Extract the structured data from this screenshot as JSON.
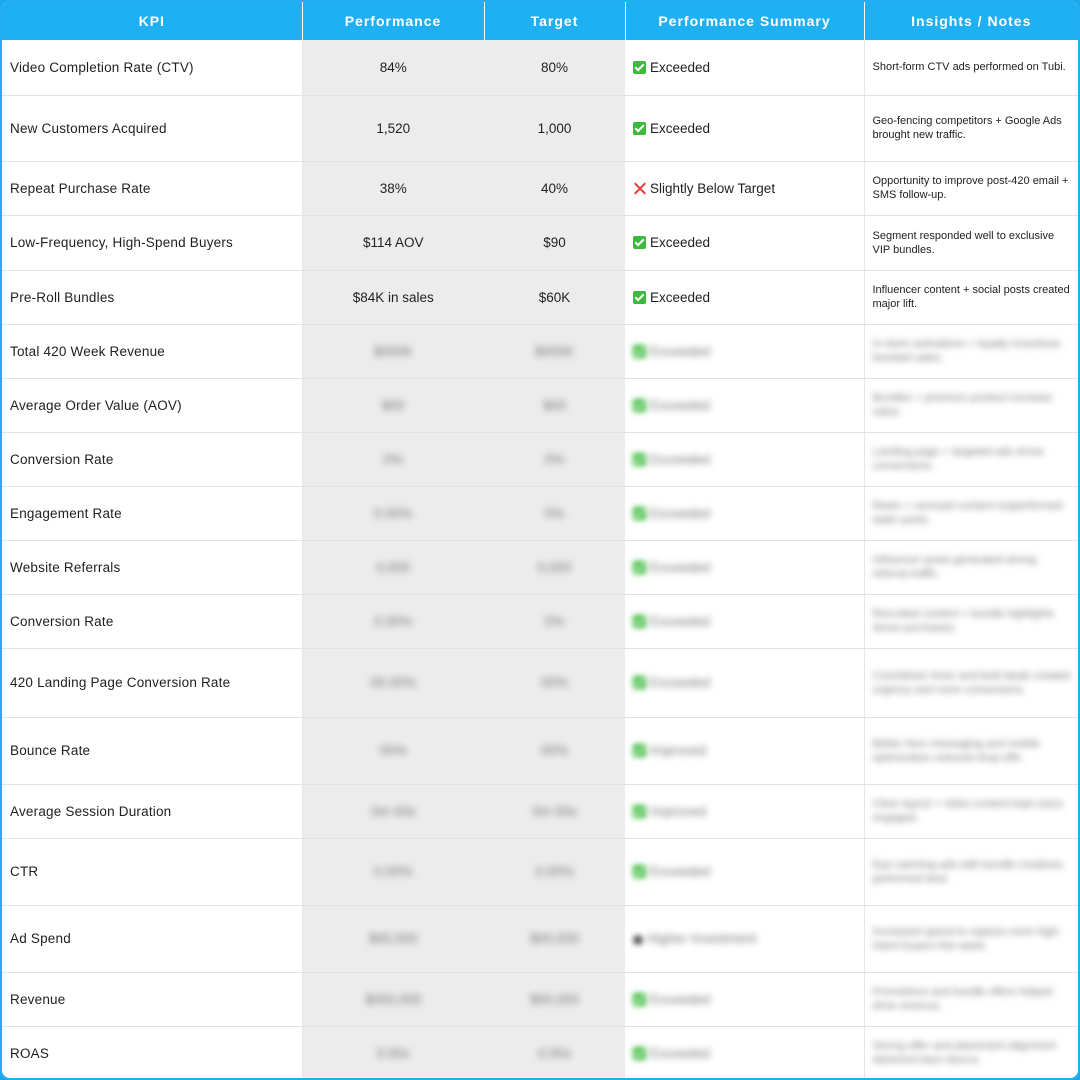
{
  "headers": {
    "kpi": "KPI",
    "performance": "Performance",
    "target": "Target",
    "summary": "Performance Summary",
    "notes": "Insights / Notes"
  },
  "rows": [
    {
      "kpi": "Video Completion Rate (CTV)",
      "performance": "84%",
      "target": "80%",
      "status_icon": "check-icon",
      "summary": "Exceeded",
      "notes": "Short-form CTV ads performed on Tubi."
    },
    {
      "kpi": "New Customers Acquired",
      "performance": "1,520",
      "target": "1,000",
      "status_icon": "check-icon",
      "summary": "Exceeded",
      "notes": "Geo-fencing competitors + Google Ads brought new traffic."
    },
    {
      "kpi": "Repeat Purchase Rate",
      "performance": "38%",
      "target": "40%",
      "status_icon": "cross-icon",
      "summary": "Slightly Below Target",
      "notes": "Opportunity to improve post-420 email + SMS follow-up."
    },
    {
      "kpi": "Low-Frequency, High-Spend Buyers",
      "performance": "$114 AOV",
      "target": "$90",
      "status_icon": "check-icon",
      "summary": "Exceeded",
      "notes": "Segment responded well to exclusive VIP bundles."
    },
    {
      "kpi": "Pre-Roll Bundles",
      "performance": "$84K in sales",
      "target": "$60K",
      "status_icon": "check-icon",
      "summary": "Exceeded",
      "notes": "Influencer content + social posts created major lift."
    },
    {
      "kpi": "Total 420 Week Revenue",
      "performance": "$000K",
      "target": "$000K",
      "status_icon": "check-icon",
      "summary": "Exceeded",
      "notes": "In-store activations + loyalty incentives boosted sales."
    },
    {
      "kpi": "Average Order Value (AOV)",
      "performance": "$00",
      "target": "$00",
      "status_icon": "check-icon",
      "summary": "Exceeded",
      "notes": "Bundles + premium product increase value."
    },
    {
      "kpi": "Conversion Rate",
      "performance": "0%",
      "target": "0%",
      "status_icon": "check-icon",
      "summary": "Exceeded",
      "notes": "Landing page + targeted ads drove conversions."
    },
    {
      "kpi": "Engagement Rate",
      "performance": "0.00%",
      "target": "0%",
      "status_icon": "check-icon",
      "summary": "Exceeded",
      "notes": "Reels + carousel content outperformed static posts."
    },
    {
      "kpi": "Website Referrals",
      "performance": "0,000",
      "target": "0,000",
      "status_icon": "check-icon",
      "summary": "Exceeded",
      "notes": "Influencer posts generated strong referral traffic."
    },
    {
      "kpi": "Conversion Rate",
      "performance": "0.00%",
      "target": "0%",
      "status_icon": "check-icon",
      "summary": "Exceeded",
      "notes": "Recruited content + bundle highlights drove purchases."
    },
    {
      "kpi": "420 Landing Page Conversion Rate",
      "performance": "00.00%",
      "target": "00%",
      "status_icon": "check-icon",
      "summary": "Exceeded",
      "notes": "Countdown timer and bold deals created urgency and more conversions."
    },
    {
      "kpi": "Bounce Rate",
      "performance": "00%",
      "target": "00%",
      "status_icon": "check-icon",
      "summary": "Improved",
      "notes": "Better hero messaging and mobile optimization reduced drop-offs."
    },
    {
      "kpi": "Average Session Duration",
      "performance": "0m 00s",
      "target": "0m 00s",
      "status_icon": "check-icon",
      "summary": "Improved",
      "notes": "Clear layout + video content kept users engaged."
    },
    {
      "kpi": "CTR",
      "performance": "0.00%",
      "target": "0.00%",
      "status_icon": "check-icon",
      "summary": "Exceeded",
      "notes": "Eye-catching ads with bundle creatives performed best."
    },
    {
      "kpi": "Ad Spend",
      "performance": "$00,000",
      "target": "$00,000",
      "status_icon": "dot-icon",
      "summary": "Higher Investment",
      "notes": "Increased spend to capture more high-intent buyers this week."
    },
    {
      "kpi": "Revenue",
      "performance": "$000,000",
      "target": "$00,000",
      "status_icon": "check-icon",
      "summary": "Exceeded",
      "notes": "Promotions and bundle offers helped drive revenue."
    },
    {
      "kpi": "ROAS",
      "performance": "0.00x",
      "target": "0.00x",
      "status_icon": "check-icon",
      "summary": "Exceeded",
      "notes": "Strong offer and placement alignment delivered best returns."
    }
  ],
  "colors": {
    "header_bg": "#1eb0f2",
    "check": "#3dba3d",
    "cross": "#e23b3b",
    "shaded_col": "#ececec"
  }
}
